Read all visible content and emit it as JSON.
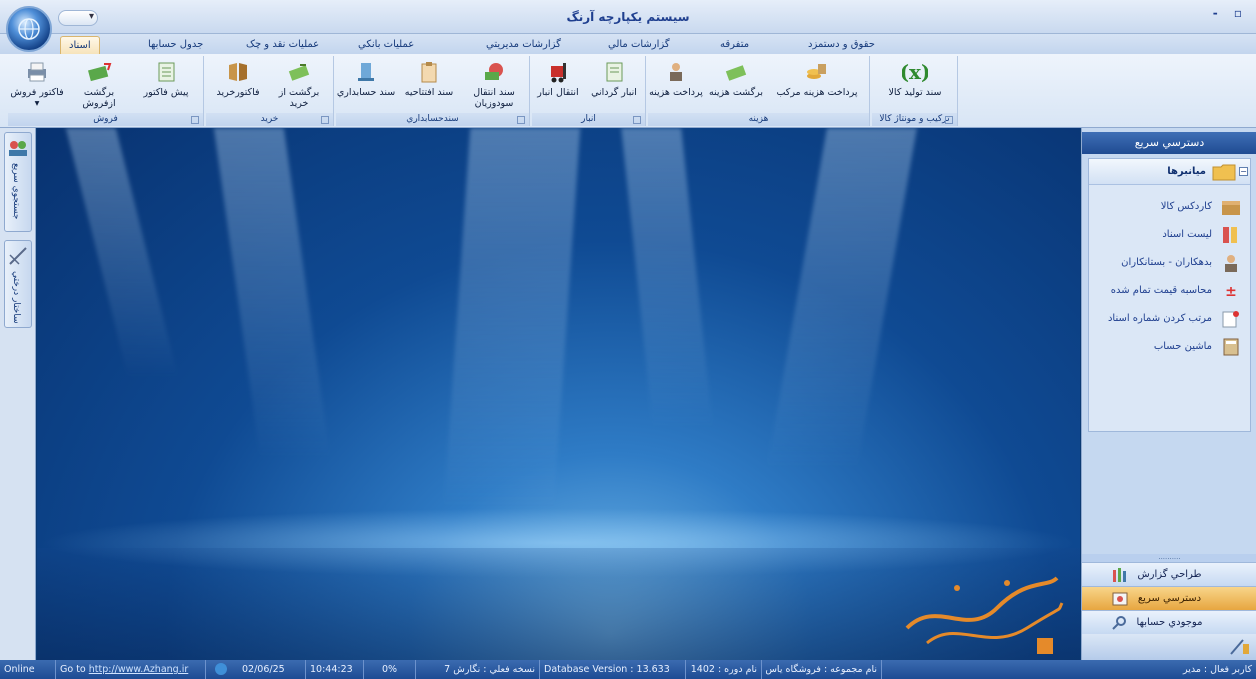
{
  "window": {
    "title": "سيستم يكپارچه آرنگ",
    "controls": "- ▫"
  },
  "quick_access": {
    "dropdown": "▾"
  },
  "tabs": [
    {
      "label": "اسناد",
      "active": true
    },
    {
      "label": "جدول حسابها"
    },
    {
      "label": "عمليات نقد و چک"
    },
    {
      "label": "عمليات بانکي"
    },
    {
      "label": "گزارشات مديريتي"
    },
    {
      "label": "گزارشات مالي"
    },
    {
      "label": "متفرقه"
    },
    {
      "label": "حقوق و دستمزد"
    }
  ],
  "ribbon": {
    "groups": {
      "sales": {
        "label": "فروش",
        "buttons": [
          "فاکتور فروش",
          "برگشت ازفروش",
          "پيش فاکتور"
        ]
      },
      "purchase": {
        "label": "خريد",
        "buttons": [
          "فاکتورخريد",
          "برگشت از خريد"
        ]
      },
      "accounting": {
        "label": "سندحسابداري",
        "buttons": [
          "سند حسابداري",
          "سند افتتاحيه",
          "سند انتقال سودوزيان"
        ]
      },
      "warehouse": {
        "label": "انبار",
        "buttons": [
          "انتقال انبار",
          "انبار گرداني"
        ]
      },
      "cost": {
        "label": "هزينه",
        "buttons": [
          "پرداخت هزينه",
          "برگشت هزينه",
          "پرداخت هزينه مرکب"
        ]
      },
      "assembly": {
        "label": "ترکيب و مونتاژ کالا",
        "buttons": [
          "سند توليد کالا"
        ]
      }
    }
  },
  "left_dock": {
    "tabs": [
      "جستجوي سريع",
      "ساختار درختي"
    ]
  },
  "right_panel": {
    "header": "دسترسي سريع",
    "group_title": "ميانبرها",
    "collapse": "−",
    "items": [
      "کاردکس کالا",
      "ليست اسناد",
      "بدهکاران - بستانکاران",
      "محاسبه قيمت تمام شده",
      "مرتب کردن شماره اسناد",
      "ماشين حساب"
    ],
    "grip": "..........",
    "bottom_bars": [
      {
        "label": "طراحي گزارش"
      },
      {
        "label": "دسترسي سريع",
        "selected": true
      },
      {
        "label": "موجودي حسابها"
      }
    ]
  },
  "statusbar": {
    "online": "Online",
    "goto_prefix": "Go to",
    "goto_link": "http://www.Azhang.ir",
    "date": "02/06/25",
    "time": "10:44:23",
    "percent": "0%",
    "version": "نسخه فعلي : نگارش 7",
    "db_version": "Database Version : 13.633",
    "fiscal_year": "نام دوره : 1402",
    "company": "نام مجموعه : فروشگاه ياس",
    "user": "کاربر فعال : مدير"
  },
  "colors": {
    "accent": "#1f4b92",
    "selected_tab": "#f6e3bb",
    "ribbon": "#d8e5f5"
  }
}
